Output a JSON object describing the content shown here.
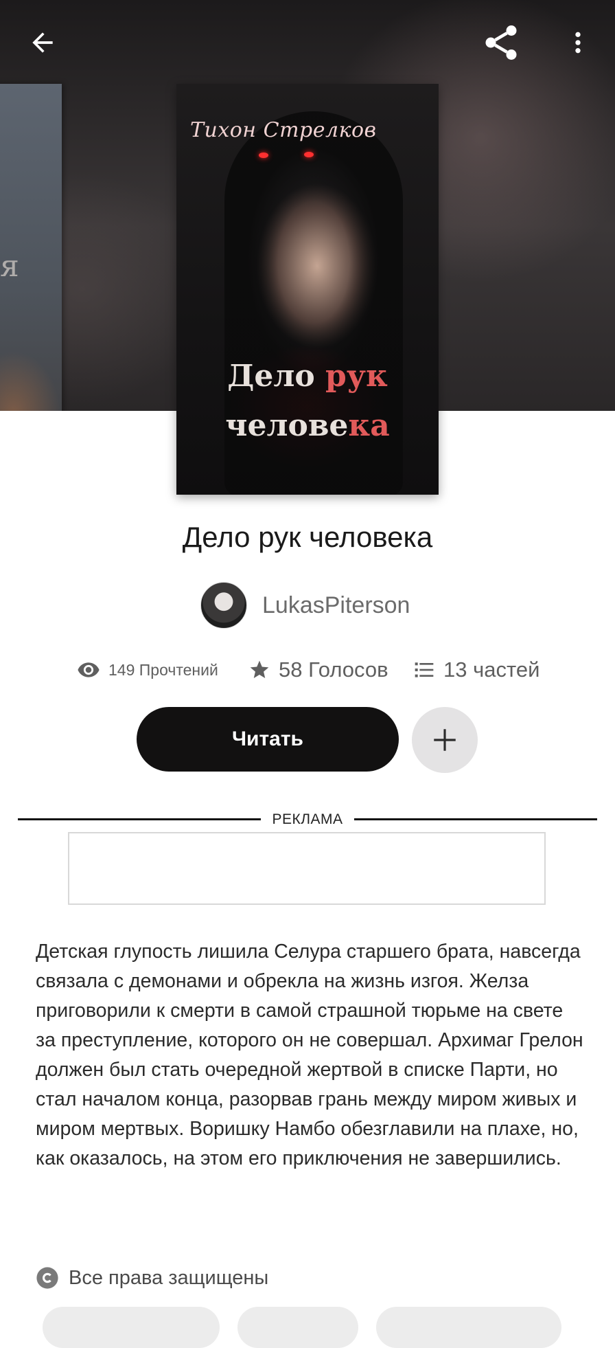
{
  "book": {
    "title": "Дело рук человека",
    "cover_author_text": "Тихон Стрелков",
    "cover_title_line1_a": "Дело ",
    "cover_title_line1_b": "рук",
    "cover_title_line2_a": "челове",
    "cover_title_line2_b": "ка",
    "side_cover_letter": "я"
  },
  "author": {
    "name": "LukasPiterson"
  },
  "stats": {
    "reads": "149 Прочтений",
    "votes": "58 Голосов",
    "parts": "13 частей"
  },
  "actions": {
    "read_label": "Читать"
  },
  "ad": {
    "label": "РЕКЛАМА"
  },
  "description": "Детская глупость лишила Селура старшего брата, навсегда связала с демонами и обрекла на жизнь изгоя. Желза приговорили к смерти в самой страшной тюрьме на свете за преступление, которого он не совершал. Архимаг Грелон должен был стать очередной жертвой в списке Парти, но стал началом конца, разорвав грань между миром живых и миром мертвых. Воришку Намбо обезглавили на плахе, но, как оказалось, на этом его приключения не завершились.",
  "rights": {
    "label": "Все права защищены"
  },
  "icons": {
    "back": "arrow-left-icon",
    "share": "share-icon",
    "more": "more-vertical-icon",
    "reads": "eye-icon",
    "votes": "star-icon",
    "parts": "list-icon",
    "add": "plus-icon",
    "copyright": "copyright-icon"
  },
  "colors": {
    "primary_button": "#121111",
    "secondary_button": "#e4e3e4",
    "text_muted": "#5f5f5f"
  }
}
